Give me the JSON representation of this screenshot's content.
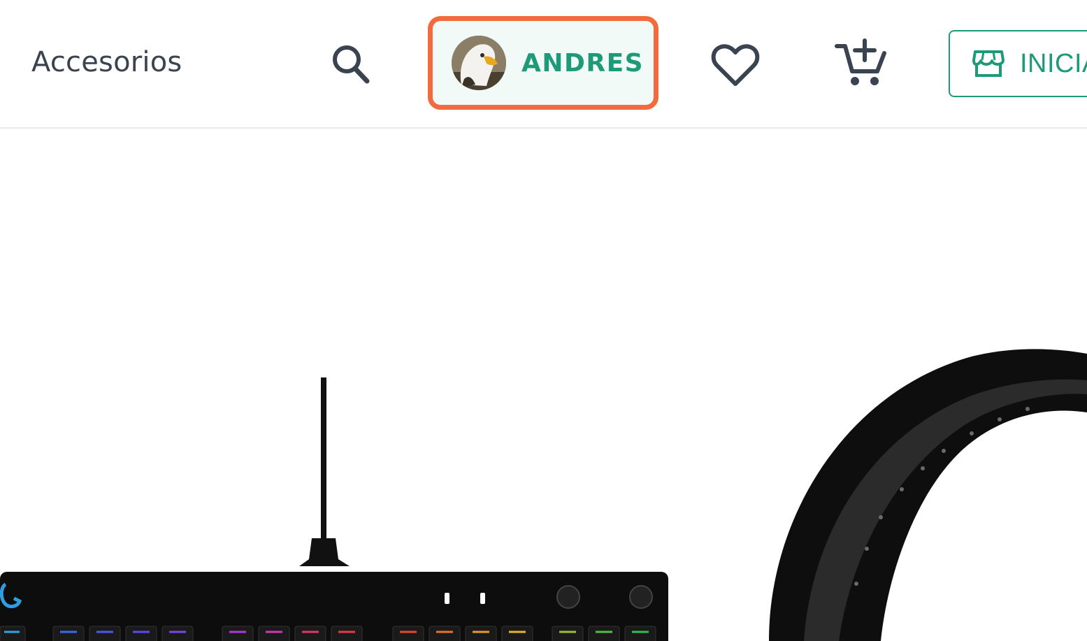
{
  "header": {
    "nav_link": "Accesorios",
    "search_icon": "search-icon",
    "user": {
      "name": "ANDRES",
      "avatar": "eagle-avatar"
    },
    "favorites_icon": "heart-icon",
    "cart_icon": "cart-add-icon",
    "login": {
      "label": "INICIA",
      "icon": "store-icon"
    }
  },
  "colors": {
    "accent_green": "#1e9a78",
    "highlight_orange": "#f26a3d",
    "text_dark": "#3a4350"
  },
  "products": [
    {
      "name_icon": "keyboard-image"
    },
    {
      "name_icon": "headset-image"
    }
  ]
}
